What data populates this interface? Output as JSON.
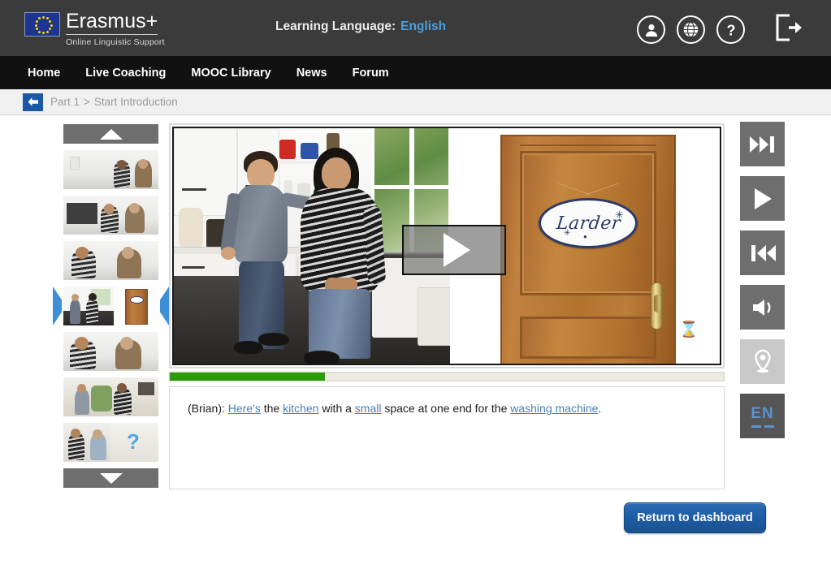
{
  "header": {
    "brand_title": "Erasmus+",
    "brand_subtitle": "Online Linguistic Support",
    "learning_language_label": "Learning Language:",
    "learning_language_value": "English",
    "accent_blue": "#4a9fe0",
    "icons": [
      {
        "name": "user-profile-icon",
        "label": "Profile"
      },
      {
        "name": "globe-icon",
        "label": "Language"
      },
      {
        "name": "help-icon",
        "label": "Help"
      },
      {
        "name": "logout-icon",
        "label": "Log out"
      }
    ]
  },
  "nav": {
    "items": [
      {
        "label": "Home"
      },
      {
        "label": "Live Coaching"
      },
      {
        "label": "MOOC Library"
      },
      {
        "label": "News"
      },
      {
        "label": "Forum"
      }
    ]
  },
  "breadcrumb": {
    "back_label": "Back",
    "part": "Part 1",
    "separator": ">",
    "current": "Start Introduction"
  },
  "thumbnails": {
    "scroll_up_label": "Scroll up",
    "scroll_down_label": "Scroll down",
    "selected_index": 3,
    "items": [
      {
        "caption": "Two men talking by a wall"
      },
      {
        "caption": "Men by a blackboard shaking hands"
      },
      {
        "caption": "Men greeting in a room"
      },
      {
        "caption": "Kitchen scene and larder door"
      },
      {
        "caption": "Two men in conversation"
      },
      {
        "caption": "Men near a plant in a hallway"
      },
      {
        "caption": "Man talking and question mark"
      }
    ]
  },
  "video": {
    "play_label": "Play",
    "left_scene_caption": "Two men talking in a white kitchen",
    "right_scene_caption": "Wooden door with a Larder sign",
    "door_sign_text": "Larder",
    "cursor_icon": "hourglass-icon",
    "progress_percent": 28,
    "progress_color": "#2d9b0e"
  },
  "transcript": {
    "speaker": "(Brian):",
    "segments": [
      {
        "text": "Here's",
        "link": true
      },
      {
        "text": " the ",
        "link": false
      },
      {
        "text": "kitchen",
        "link": true
      },
      {
        "text": " with a ",
        "link": false
      },
      {
        "text": "small",
        "link": true
      },
      {
        "text": " space at one end for the ",
        "link": false
      },
      {
        "text": "washing machine",
        "link": true
      },
      {
        "text": ".",
        "link": false
      }
    ],
    "full_text": "(Brian): Here's the kitchen with a small space at one end for the washing machine."
  },
  "controls": [
    {
      "name": "fast-forward-button",
      "label": "Fast forward",
      "state": "enabled"
    },
    {
      "name": "play-button",
      "label": "Play",
      "state": "enabled"
    },
    {
      "name": "rewind-button",
      "label": "Rewind",
      "state": "enabled"
    },
    {
      "name": "volume-button",
      "label": "Volume",
      "state": "enabled"
    },
    {
      "name": "location-pin-button",
      "label": "Location",
      "state": "disabled"
    },
    {
      "name": "language-toggle-button",
      "label": "EN",
      "state": "enabled"
    }
  ],
  "footer": {
    "return_button_label": "Return to dashboard"
  }
}
